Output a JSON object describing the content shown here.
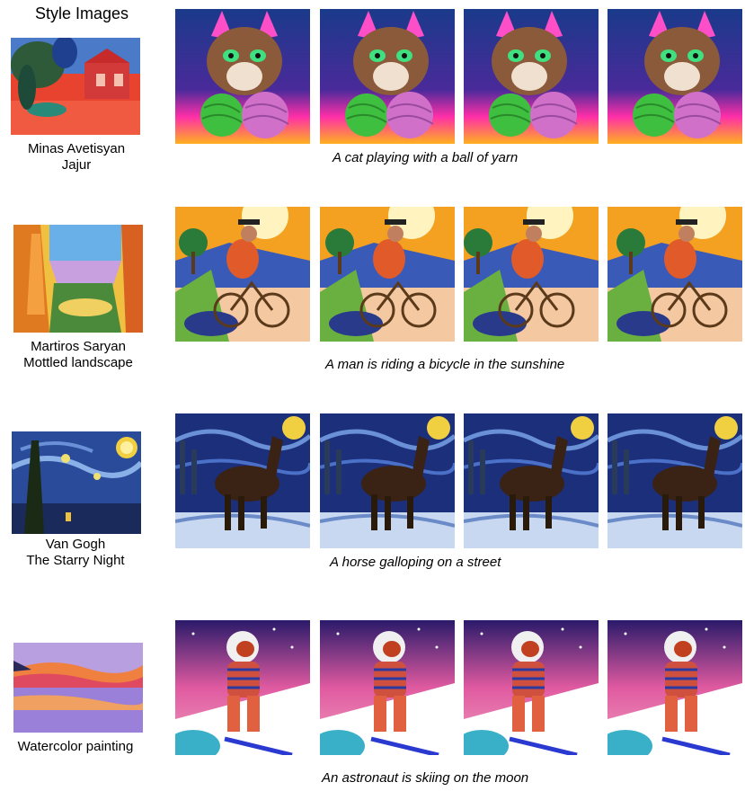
{
  "header": "Style Images",
  "rows": [
    {
      "style_name": "Minas Avetisyan",
      "style_work": "Jajur",
      "prompt": "A cat playing with a ball of yarn",
      "subject": "cat"
    },
    {
      "style_name": "Martiros Saryan",
      "style_work": "Mottled landscape",
      "prompt": "A man is riding a bicycle in the sunshine",
      "subject": "bicycle"
    },
    {
      "style_name": "Van Gogh",
      "style_work": "The Starry Night",
      "prompt": "A horse galloping on a street",
      "subject": "horse"
    },
    {
      "style_name": "Watercolor painting",
      "style_work": "",
      "prompt": "An astronaut is skiing on the moon",
      "subject": "astronaut"
    }
  ],
  "colors": {
    "cat_bg_top": "#1a3a8a",
    "cat_bg_pink": "#ff2fa8",
    "yarn_green": "#3fbf3f",
    "yarn_pink": "#d070c8",
    "bike_sky": "#f4a020",
    "bike_shirt": "#e05a2a",
    "starry_blue": "#1c2f7a",
    "starry_moon": "#f0d040",
    "astro_sky": "#5a2fa0",
    "astro_snow": "#ffffff"
  }
}
